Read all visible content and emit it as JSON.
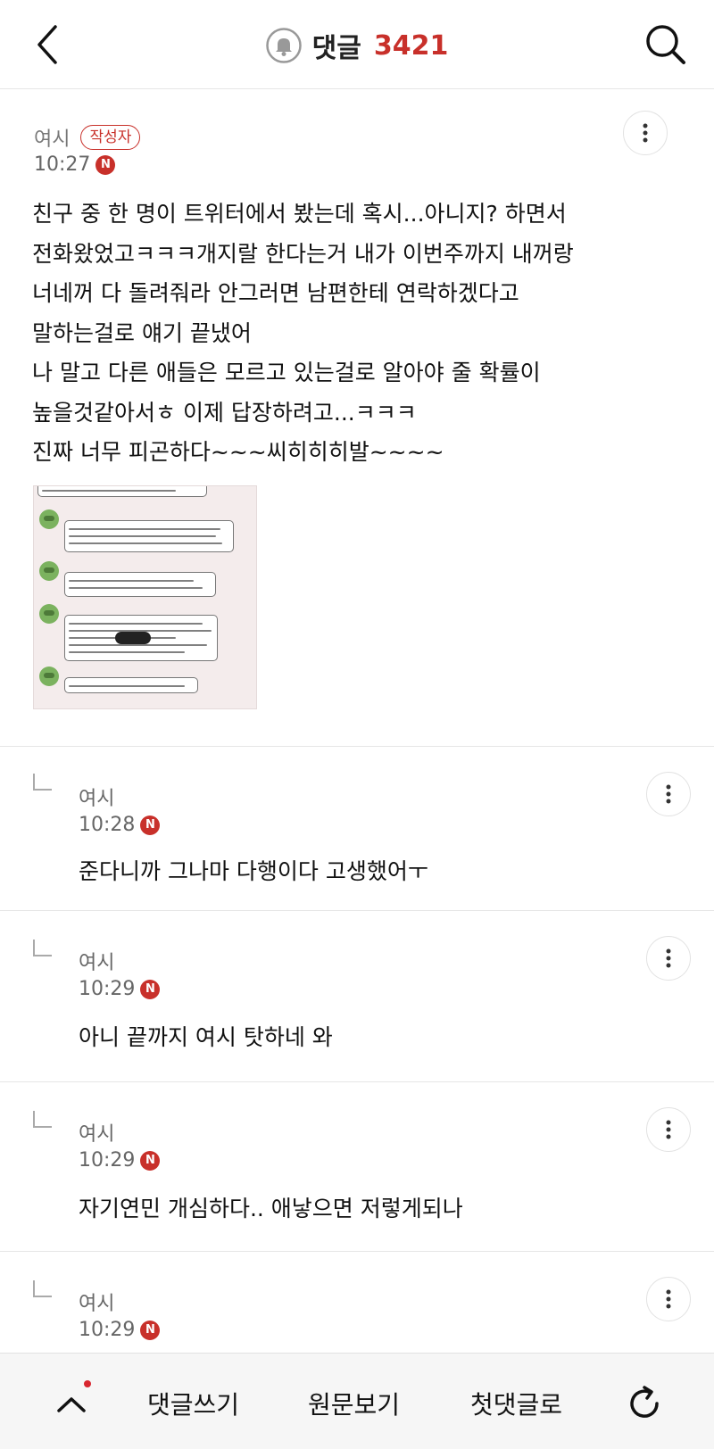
{
  "header": {
    "title": "댓글",
    "count": "3421",
    "icons": {
      "back": "back-icon",
      "bell": "bell-icon",
      "search": "search-icon"
    }
  },
  "post": {
    "author": "여시",
    "badge": "작성자",
    "time": "10:27",
    "new_badge": "N",
    "lines": [
      "친구 중 한 명이 트위터에서 봤는데 혹시...아니지? 하면서",
      "전화왔었고ㅋㅋㅋ개지랄 한다는거 내가 이번주까지 내꺼랑",
      "너네꺼 다 돌려줘라 안그러면 남편한테 연락하겠다고",
      "말하는걸로 얘기 끝냈어",
      "나 말고 다른 애들은 모르고 있는걸로 알아야 줄 확률이",
      "높을것같아서ㅎ 이제 답장하려고...ㅋㅋㅋ",
      "진짜 너무 피곤하다~~~씨히히히발~~~~"
    ],
    "image": "chat-screenshot"
  },
  "replies": [
    {
      "author": "여시",
      "time": "10:28",
      "new_badge": "N",
      "body": "준다니까 그나마 다행이다 고생했어ㅜ"
    },
    {
      "author": "여시",
      "time": "10:29",
      "new_badge": "N",
      "body": "아니 끝까지 여시 탓하네 와"
    },
    {
      "author": "여시",
      "time": "10:29",
      "new_badge": "N",
      "body": "자기연민 개심하다.. 애낳으면 저렇게되나"
    },
    {
      "author": "여시",
      "time": "10:29",
      "new_badge": "N",
      "body": ""
    }
  ],
  "bottom_bar": {
    "up_icon": "chevron-up-icon",
    "write": "댓글쓰기",
    "original": "원문보기",
    "first": "첫댓글로",
    "refresh_icon": "refresh-icon"
  },
  "colors": {
    "accent": "#c8302a",
    "border": "#e6e6e6",
    "bar_bg": "#f6f6f6"
  }
}
